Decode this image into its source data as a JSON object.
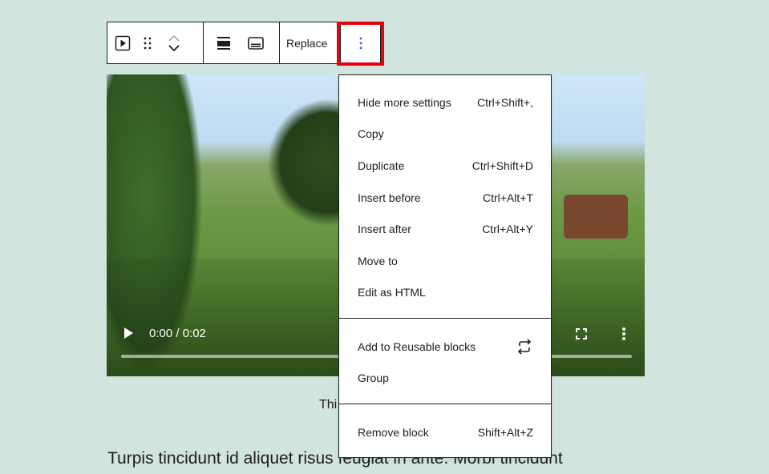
{
  "toolbar": {
    "replace_label": "Replace"
  },
  "video": {
    "time": "0:00 / 0:02"
  },
  "caption": "Thi",
  "paragraph": "Turpis tincidunt id aliquet risus feugiat in ante. Morbi tincidunt",
  "menu": {
    "section1": [
      {
        "label": "Hide more settings",
        "shortcut": "Ctrl+Shift+,"
      },
      {
        "label": "Copy",
        "shortcut": ""
      },
      {
        "label": "Duplicate",
        "shortcut": "Ctrl+Shift+D"
      },
      {
        "label": "Insert before",
        "shortcut": "Ctrl+Alt+T"
      },
      {
        "label": "Insert after",
        "shortcut": "Ctrl+Alt+Y"
      },
      {
        "label": "Move to",
        "shortcut": ""
      },
      {
        "label": "Edit as HTML",
        "shortcut": ""
      }
    ],
    "section2": [
      {
        "label": "Add to Reusable blocks",
        "icon": "reusable-icon"
      },
      {
        "label": "Group"
      }
    ],
    "section3": [
      {
        "label": "Remove block",
        "shortcut": "Shift+Alt+Z"
      }
    ]
  },
  "colors": {
    "background": "#d2e4de",
    "accent": "#3858e9",
    "highlight": "#e8000f"
  }
}
